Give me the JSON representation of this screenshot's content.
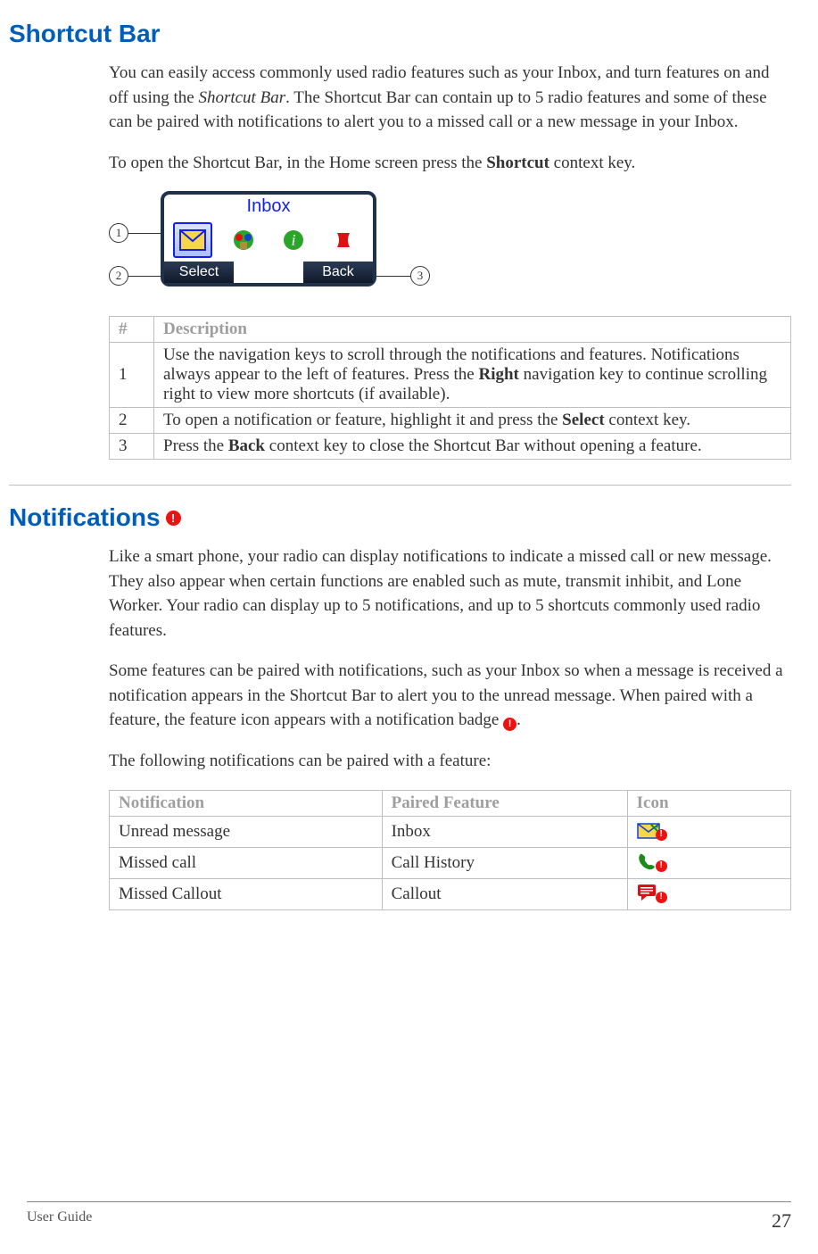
{
  "section1": {
    "title": "Shortcut Bar",
    "para1_pre": "You can easily access commonly used radio features such as your Inbox, and turn features on and off using the ",
    "para1_em": "Shortcut Bar",
    "para1_post": ". The Shortcut Bar can contain up to 5 radio features and some of these can be paired with notifications to alert you to a missed call or a new message in your Inbox.",
    "para2_pre": "To open the Shortcut Bar, in the Home screen press the ",
    "para2_bold": "Shortcut",
    "para2_post": " context key.",
    "figure": {
      "title": "Inbox",
      "softkey_left": "Select",
      "softkey_right": "Back",
      "callout1": "1",
      "callout2": "2",
      "callout3": "3"
    },
    "table": {
      "hdr_num": "#",
      "hdr_desc": "Description",
      "rows": [
        {
          "num": "1",
          "seg1": "Use the navigation keys to scroll through the notifications and features. Notifications always appear to the left of features. Press the ",
          "bold": "Right",
          "seg2": " navigation key to continue scrolling right to view more shortcuts (if available)."
        },
        {
          "num": "2",
          "seg1": "To open a notification or feature, highlight it and press the ",
          "bold": "Select",
          "seg2": " context key."
        },
        {
          "num": "3",
          "seg1": "Press the ",
          "bold": "Back",
          "seg2": " context key to close the Shortcut Bar without opening a feature."
        }
      ]
    }
  },
  "section2": {
    "title": "Notifications",
    "para1": "Like a smart phone, your radio can display notifications to indicate a missed call or new message. They also appear when certain functions are enabled such as mute, transmit inhibit, and Lone Worker. Your radio can display up to 5 notifications, and up to 5 shortcuts commonly used radio features.",
    "para2_pre": "Some features can be paired with notifications, such as your Inbox so when a message is received a notification appears in the Shortcut Bar to alert you to the unread message. When paired with a feature, the feature icon appears with a notification badge ",
    "para2_post": ".",
    "para3": "The following notifications can be paired with a feature:",
    "table": {
      "hdr_notif": "Notification",
      "hdr_feat": "Paired Feature",
      "hdr_icon": "Icon",
      "rows": [
        {
          "notification": "Unread message",
          "feature": "Inbox",
          "icon": "envelope"
        },
        {
          "notification": "Missed call",
          "feature": "Call History",
          "icon": "phone"
        },
        {
          "notification": "Missed Callout",
          "feature": "Callout",
          "icon": "callout"
        }
      ]
    }
  },
  "footer": {
    "left": "User Guide",
    "right": "27"
  }
}
